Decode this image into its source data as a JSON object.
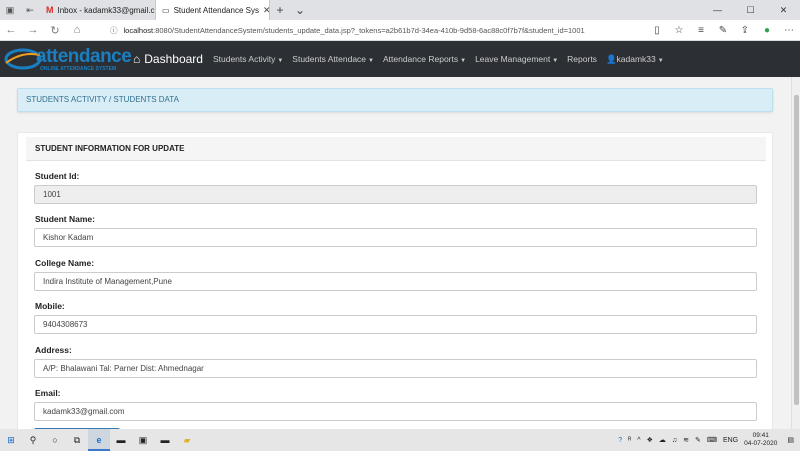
{
  "browser": {
    "tabs": [
      {
        "label": "Inbox - kadamk33@gmail.c"
      },
      {
        "label": "Student Attendance Sys"
      }
    ],
    "url_host": "localhost",
    "url_rest": ":8080/StudentAttendanceSystem/students_update_data.jsp?_tokens=a2b61b7d-34ea-410b-9d58-6ac88c0f7b7f&student_id=1001",
    "window_controls": {
      "minimize": "—",
      "maximize": "☐",
      "close": "✕"
    }
  },
  "app": {
    "logo_word": "attendance",
    "logo_tagline": "ONLINE ATTENDANCE SYSTEM",
    "brand_label": "Dashboard",
    "menu": [
      "Students Activity",
      "Students Attendace",
      "Attendance Reports",
      "Leave Management",
      "Reports"
    ],
    "user": "kadamk33"
  },
  "breadcrumb": "STUDENTS ACTIVITY / STUDENTS DATA",
  "panel_title": "STUDENT INFORMATION FOR UPDATE",
  "form": {
    "student_id_label": "Student Id:",
    "student_id": "1001",
    "name_label": "Student Name:",
    "name": "Kishor Kadam",
    "college_label": "College Name:",
    "college": "Indira Institute of Management,Pune",
    "mobile_label": "Mobile:",
    "mobile": "9404308673",
    "address_label": "Address:",
    "address": "A/P: Bhalawani Tal: Parner Dist: Ahmednagar",
    "email_label": "Email:",
    "email": "kadamk33@gmail.com"
  },
  "taskbar": {
    "lang": "ENG",
    "time": "09:41",
    "date": "04-07-2020"
  },
  "colors": {
    "navbar_bg": "#2c3035",
    "breadcrumb_bg": "#d9edf7",
    "breadcrumb_text": "#31708f",
    "accent": "#337ab7"
  }
}
